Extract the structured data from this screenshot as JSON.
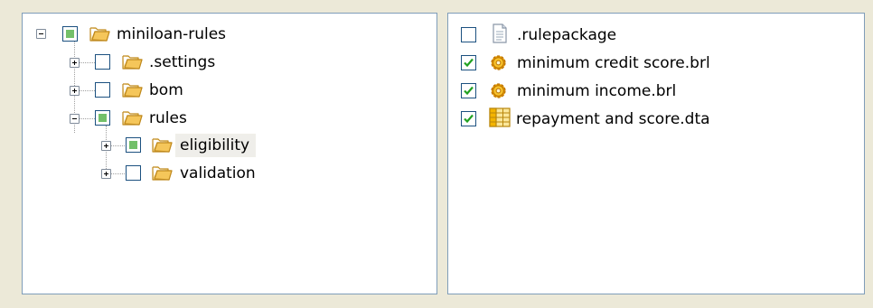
{
  "tree": {
    "root": {
      "label": "miniloan-rules"
    },
    "settings": {
      "label": ".settings"
    },
    "bom": {
      "label": "bom"
    },
    "rules": {
      "label": "rules"
    },
    "eligibility": {
      "label": "eligibility"
    },
    "validation": {
      "label": "validation"
    }
  },
  "files": [
    {
      "label": ".rulepackage",
      "checked": false,
      "icon": "document-icon"
    },
    {
      "label": "minimum credit score.brl",
      "checked": true,
      "icon": "rule-gear-icon"
    },
    {
      "label": "minimum income.brl",
      "checked": true,
      "icon": "rule-gear-icon"
    },
    {
      "label": "repayment and score.dta",
      "checked": true,
      "icon": "decision-table-icon"
    }
  ],
  "colors": {
    "partial_check": "#73c06a",
    "checkmark": "#21a121",
    "folder": "#f5c65a",
    "selection": "#efeeea"
  }
}
